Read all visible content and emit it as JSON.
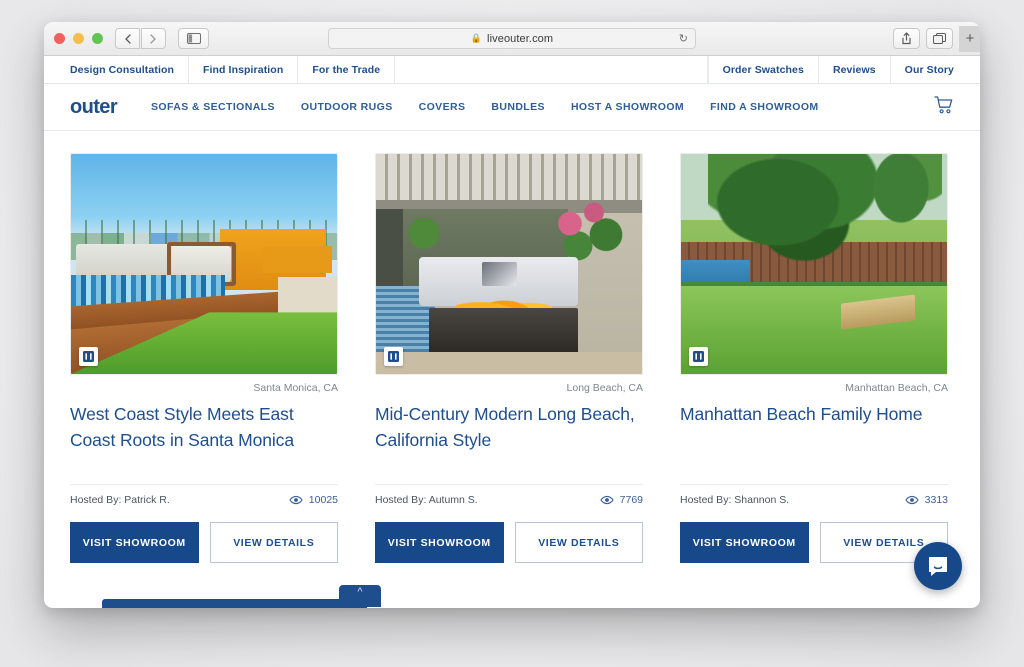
{
  "browser": {
    "url": "liveouter.com",
    "lock_icon": "lock-icon",
    "reload_icon": "reload-icon",
    "back_icon": "chevron-left-icon",
    "forward_icon": "chevron-right-icon",
    "sidebar_icon": "sidebar-toggle-icon",
    "share_icon": "share-icon",
    "tabs_icon": "tab-overview-icon",
    "new_tab_label": "+"
  },
  "utility_nav": {
    "left": [
      {
        "label": "Design Consultation"
      },
      {
        "label": "Find Inspiration"
      },
      {
        "label": "For the Trade"
      }
    ],
    "right": [
      {
        "label": "Order Swatches"
      },
      {
        "label": "Reviews"
      },
      {
        "label": "Our Story"
      }
    ]
  },
  "main_nav": {
    "logo": "outer",
    "links": [
      {
        "label": "SOFAS & SECTIONALS"
      },
      {
        "label": "OUTDOOR RUGS"
      },
      {
        "label": "COVERS"
      },
      {
        "label": "BUNDLES"
      },
      {
        "label": "HOST A SHOWROOM"
      },
      {
        "label": "FIND A SHOWROOM"
      }
    ],
    "cart_icon": "shopping-cart-icon"
  },
  "cards": [
    {
      "location": "Santa Monica, CA",
      "title": "West Coast Style Meets East Coast Roots in Santa Monica",
      "host": "Hosted By: Patrick R.",
      "views": "10025",
      "views_icon": "eye-icon",
      "badge_icon": "outer-logo-badge-icon",
      "primary_label": "VISIT SHOWROOM",
      "secondary_label": "VIEW DETAILS"
    },
    {
      "location": "Long Beach, CA",
      "title": "Mid-Century Modern Long Beach, California Style",
      "host": "Hosted By: Autumn S.",
      "views": "7769",
      "views_icon": "eye-icon",
      "badge_icon": "outer-logo-badge-icon",
      "primary_label": "VISIT SHOWROOM",
      "secondary_label": "VIEW DETAILS"
    },
    {
      "location": "Manhattan Beach, CA",
      "title": "Manhattan Beach Family Home",
      "host": "Hosted By: Shannon S.",
      "views": "3313",
      "views_icon": "eye-icon",
      "badge_icon": "outer-logo-badge-icon",
      "primary_label": "VISIT SHOWROOM",
      "secondary_label": "VIEW DETAILS"
    }
  ],
  "sticky_bar": {
    "expand_icon": "chevron-up-icon"
  },
  "chat": {
    "icon": "chat-bubble-icon"
  },
  "colors": {
    "brand_navy": "#1f4e8c",
    "button_navy": "#17498a",
    "link_blue": "#2f5d94",
    "muted_text": "#7d8791"
  }
}
